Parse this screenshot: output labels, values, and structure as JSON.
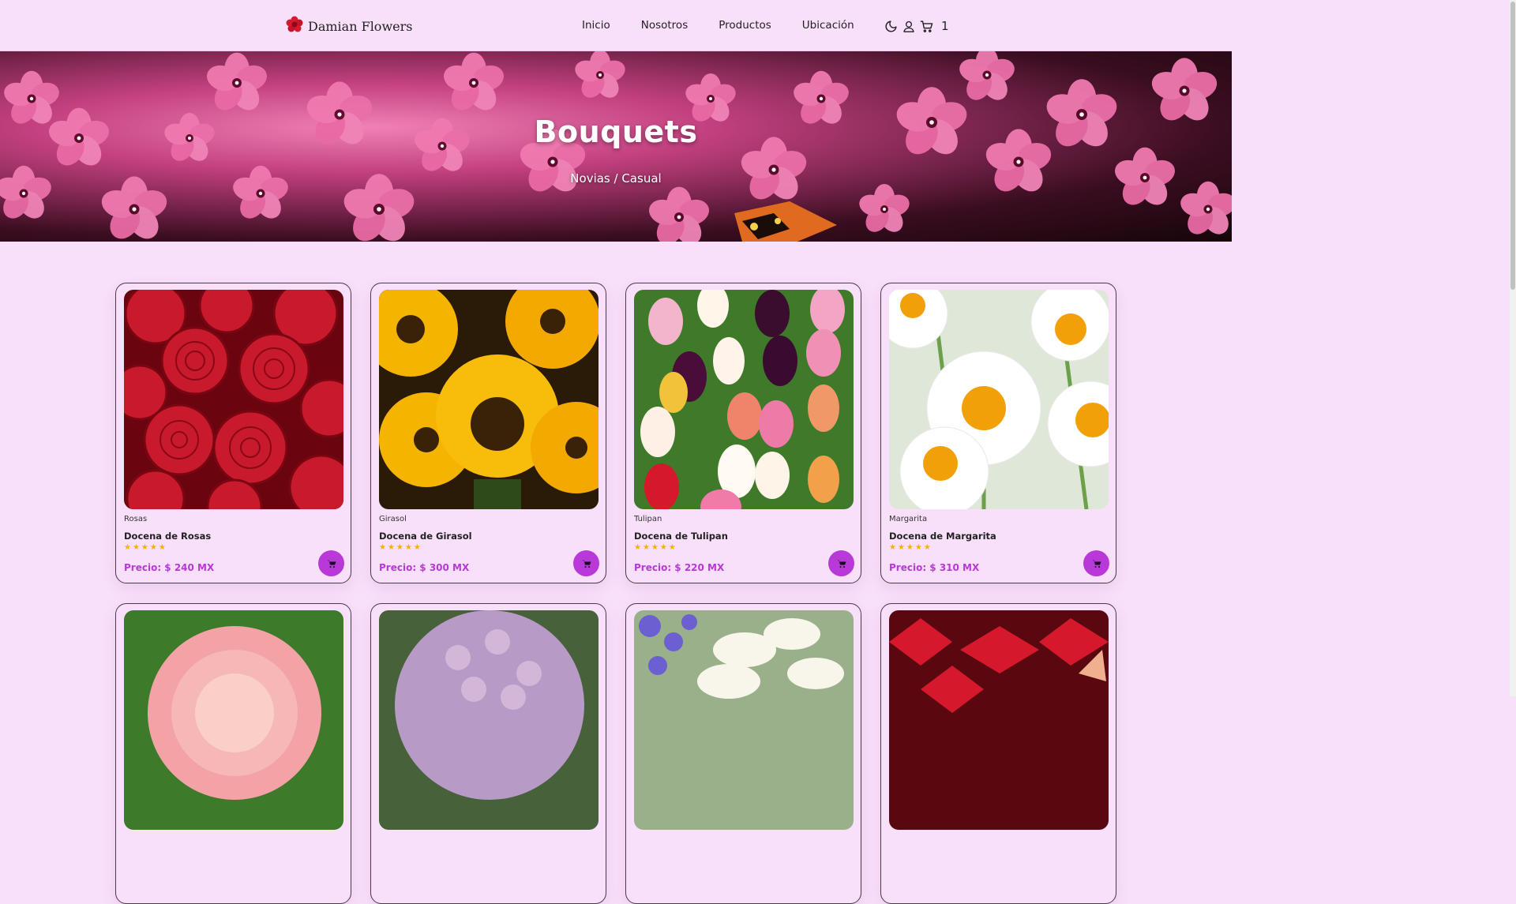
{
  "navbar": {
    "brand": "Damian Flowers",
    "links": [
      "Inicio",
      "Nosotros",
      "Productos",
      "Ubicación"
    ],
    "cart_count": "1"
  },
  "hero": {
    "title": "Bouquets",
    "breadcrumb": "Novias / Casual"
  },
  "products": [
    {
      "category": "Rosas",
      "name": "Docena de Rosas",
      "stars": "★★★★★",
      "price": "Precio: $ 240 MX"
    },
    {
      "category": "Girasol",
      "name": "Docena de Girasol",
      "stars": "★★★★★",
      "price": "Precio: $ 300 MX"
    },
    {
      "category": "Tulipan",
      "name": "Docena de Tulipan",
      "stars": "★★★★★",
      "price": "Precio: $ 220 MX"
    },
    {
      "category": "Margarita",
      "name": "Docena de Margarita",
      "stars": "★★★★★",
      "price": "Precio: $ 310 MX"
    }
  ],
  "colors": {
    "background": "#f9e0fa",
    "accent": "#b838d8",
    "star": "#f0b400"
  }
}
